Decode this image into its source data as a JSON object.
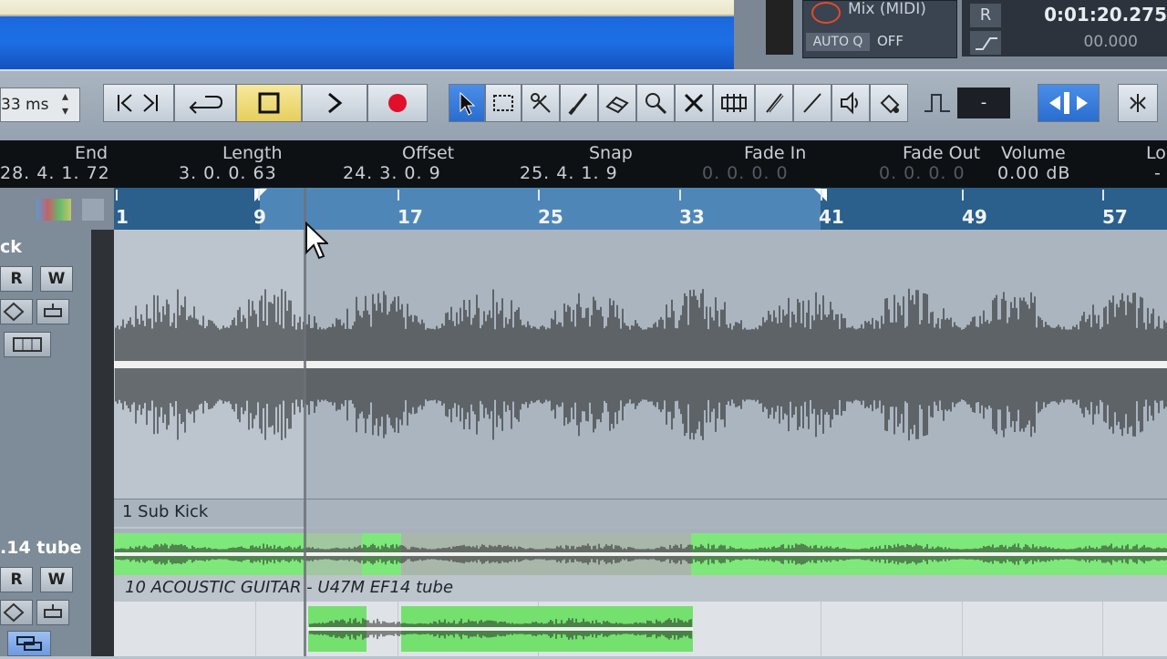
{
  "window": {
    "mix_label": "Mix (MIDI)",
    "autoq_label": "AUTO Q",
    "autoq_value": "OFF",
    "r_label": "R",
    "time_primary": "0:01:20.275",
    "time_secondary": "00.000"
  },
  "toolbar": {
    "latency": "33 ms",
    "transport": [
      "goto-start",
      "goto-end",
      "cycle",
      "stop",
      "play",
      "record"
    ],
    "tools": [
      "object-select",
      "range-select",
      "split",
      "glue",
      "erase",
      "zoom",
      "mute",
      "time-warp",
      "draw",
      "line",
      "play-audition",
      "color"
    ],
    "quantize_value": "-"
  },
  "infoline": {
    "headers": [
      "End",
      "Length",
      "Offset",
      "Snap",
      "Fade In",
      "Fade Out",
      "Volume",
      "Lo"
    ],
    "values": [
      "28. 4. 1. 72",
      "3. 0. 0. 63",
      "24. 3. 0. 9",
      "25. 4. 1. 9",
      "0. 0. 0. 0",
      "0. 0. 0. 0",
      "0.00 dB",
      "-"
    ]
  },
  "ruler": {
    "labels": [
      "1",
      "9",
      "17",
      "25",
      "33",
      "41",
      "49",
      "57"
    ]
  },
  "tracks": [
    {
      "name": "ck",
      "event_name": "1 Sub Kick",
      "r": "R",
      "w": "W"
    },
    {
      "name": ".14 tube",
      "event_name": "10 ACOUSTIC GUITAR - U47M EF14 tube",
      "r": "R",
      "w": "W"
    }
  ],
  "colors": {
    "event_green": "#7ee87a",
    "ruler_blue": "#2b5f8c",
    "ruler_sel": "#4f86b8",
    "record_red": "#e0102a"
  }
}
